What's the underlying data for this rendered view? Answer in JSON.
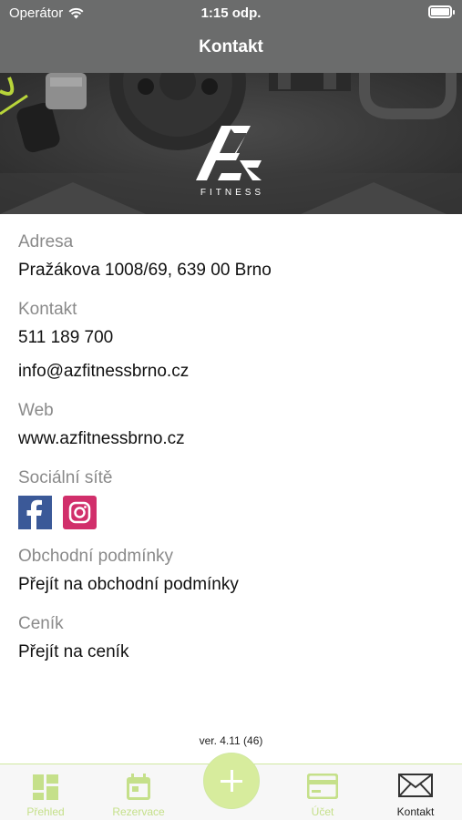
{
  "status_bar": {
    "carrier": "Operátor",
    "time": "1:15 odp."
  },
  "nav": {
    "title": "Kontakt"
  },
  "hero": {
    "logo_letters": "AZ",
    "logo_text": "FITNESS"
  },
  "sections": {
    "address_label": "Adresa",
    "address_value": "Pražákova 1008/69, 639 00 Brno",
    "contact_label": "Kontakt",
    "phone": "511 189 700",
    "email": "info@azfitnessbrno.cz",
    "web_label": "Web",
    "web_value": "www.azfitnessbrno.cz",
    "social_label": "Sociální sítě",
    "terms_label": "Obchodní podmínky",
    "terms_link": "Přejít na obchodní podmínky",
    "pricing_label": "Ceník",
    "pricing_link": "Přejít na ceník"
  },
  "version": "ver. 4.11 (46)",
  "tabs": [
    {
      "label": "Přehled",
      "icon": "dashboard-icon",
      "active": false
    },
    {
      "label": "Rezervace",
      "icon": "calendar-icon",
      "active": false
    },
    {
      "label": "",
      "icon": "plus-icon",
      "active": false
    },
    {
      "label": "Účet",
      "icon": "card-icon",
      "active": false
    },
    {
      "label": "Kontakt",
      "icon": "envelope-icon",
      "active": true
    }
  ],
  "colors": {
    "bar_gray": "#6b6c6c",
    "accent_green": "#c5e08a",
    "facebook": "#3b5998",
    "instagram": "#d12f6b"
  }
}
